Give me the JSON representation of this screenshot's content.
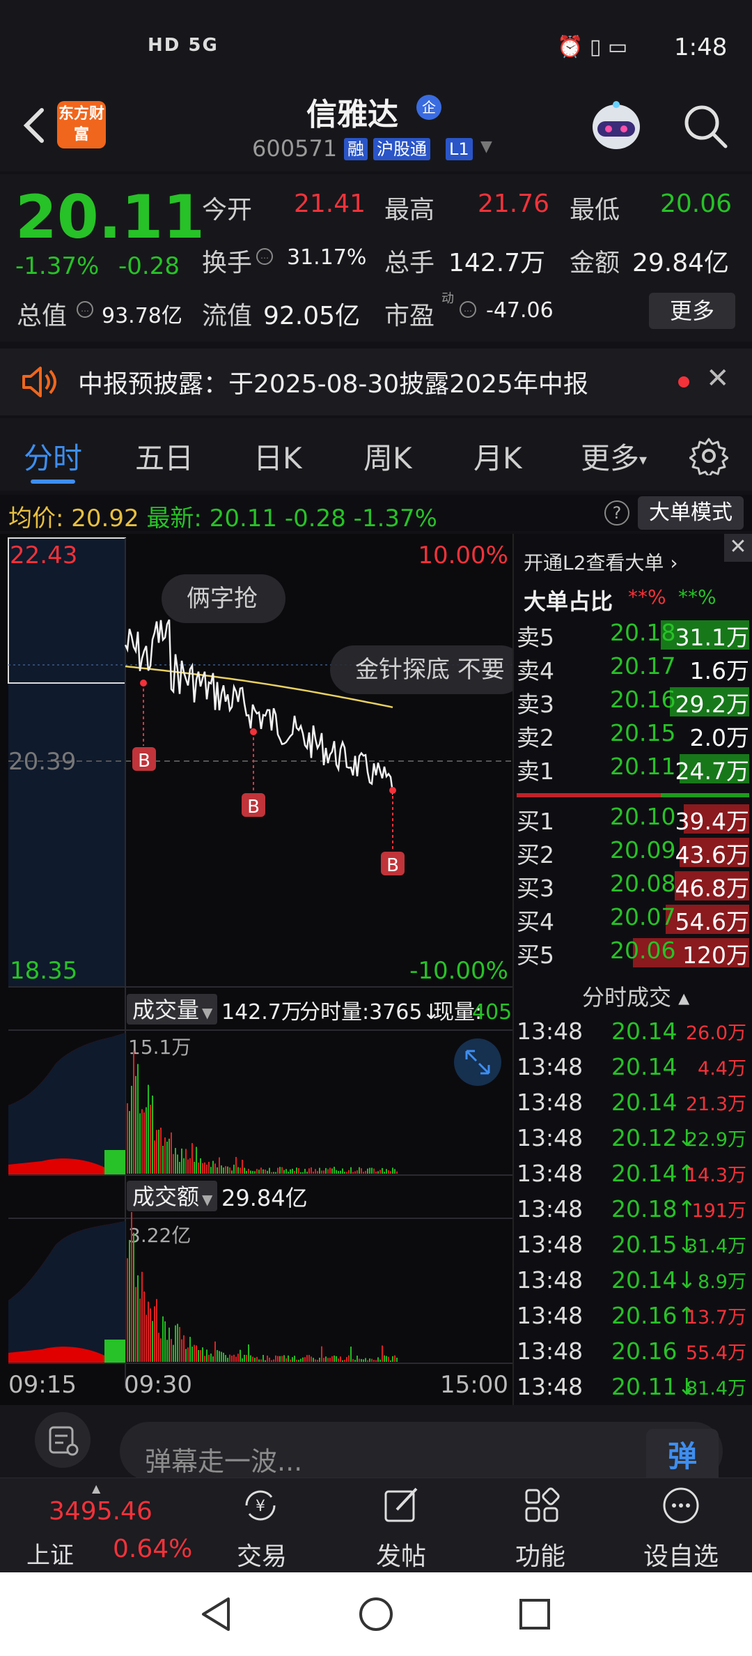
{
  "status": {
    "network": "HD 5G",
    "time": "1:48"
  },
  "header": {
    "logo": "东方财富",
    "stock_name": "信雅达",
    "qi_badge": "企",
    "stock_code": "600571",
    "tags": [
      "融",
      "沪股通",
      "L1"
    ]
  },
  "quote": {
    "price": "20.11",
    "pct": "-1.37%",
    "change": "-0.28",
    "open_label": "今开",
    "open": "21.41",
    "high_label": "最高",
    "high": "21.76",
    "low_label": "最低",
    "low": "20.06",
    "turnover_label": "换手",
    "turnover": "31.17%",
    "volume_label": "总手",
    "volume": "142.7万",
    "amount_label": "金额",
    "amount": "29.84亿",
    "mktcap_label": "总值",
    "mktcap": "93.78亿",
    "float_label": "流值",
    "float": "92.05亿",
    "pe_label": "市盈",
    "pe_sup": "动",
    "pe": "-47.06",
    "more_button": "更多"
  },
  "notice": {
    "text": "中报预披露：于2025-08-30披露2025年中报"
  },
  "tabs": [
    "分时",
    "五日",
    "日K",
    "周K",
    "月K",
    "更多"
  ],
  "avg_row": {
    "avg_label": "均价:",
    "avg": "20.92",
    "latest_label": "最新:",
    "latest": "20.11",
    "change": "-0.28",
    "pct": "-1.37%",
    "help": "?",
    "big_order_button": "大单模式"
  },
  "chart": {
    "y_top": "22.43",
    "y_mid": "20.39",
    "y_bottom": "18.35",
    "pct_top": "10.00%",
    "pct_bottom": "-10.00%",
    "bubble1": "俩字抢",
    "bubble2": "金针探底 不要",
    "marker": "B",
    "volume_label": "成交量",
    "volume_total": "142.7万",
    "fenshi_label": "分时量:3765↓",
    "xianliang_label": "现量:",
    "xianliang_value": "405",
    "vol_axis": "15.1万",
    "amount_label": "成交额",
    "amount_total": "29.84亿",
    "amt_axis": "3.22亿",
    "x_labels": [
      "09:15",
      "09:30",
      "15:00"
    ]
  },
  "right_panel": {
    "l2_link": "开通L2查看大单 ›",
    "close": "✕",
    "big_ratio_label": "大单占比",
    "big_ratio_red": "**%",
    "big_ratio_green": "**%",
    "asks": [
      {
        "label": "卖5",
        "price": "20.18",
        "vol": "31.1万",
        "bar": "green",
        "barw": 0.38
      },
      {
        "label": "卖4",
        "price": "20.17",
        "vol": "1.6万",
        "bar": "none",
        "barw": 0
      },
      {
        "label": "卖3",
        "price": "20.16",
        "vol": "29.2万",
        "bar": "green",
        "barw": 0.34
      },
      {
        "label": "卖2",
        "price": "20.15",
        "vol": "2.0万",
        "bar": "none",
        "barw": 0
      },
      {
        "label": "卖1",
        "price": "20.11",
        "vol": "24.7万",
        "bar": "green",
        "barw": 0.3
      }
    ],
    "bids": [
      {
        "label": "买1",
        "price": "20.10",
        "vol": "39.4万",
        "bar": "red",
        "barw": 0.28
      },
      {
        "label": "买2",
        "price": "20.09",
        "vol": "43.6万",
        "bar": "red",
        "barw": 0.3
      },
      {
        "label": "买3",
        "price": "20.08",
        "vol": "46.8万",
        "bar": "red",
        "barw": 0.32
      },
      {
        "label": "买4",
        "price": "20.07",
        "vol": "54.6万",
        "bar": "red",
        "barw": 0.36
      },
      {
        "label": "买5",
        "price": "20.06",
        "vol": "120万",
        "bar": "red",
        "barw": 0.5
      }
    ],
    "trades_header": "分时成交 ▴",
    "trades": [
      {
        "time": "13:48",
        "price": "20.14",
        "vol": "26.0万",
        "color": "red"
      },
      {
        "time": "13:48",
        "price": "20.14",
        "vol": "4.4万",
        "color": "red"
      },
      {
        "time": "13:48",
        "price": "20.14",
        "vol": "21.3万",
        "color": "red"
      },
      {
        "time": "13:48",
        "price": "20.12↓",
        "vol": "22.9万",
        "color": "green"
      },
      {
        "time": "13:48",
        "price": "20.14↑",
        "vol": "14.3万",
        "color": "red"
      },
      {
        "time": "13:48",
        "price": "20.18↑",
        "vol": "191万",
        "color": "red"
      },
      {
        "time": "13:48",
        "price": "20.15↓",
        "vol": "31.4万",
        "color": "green"
      },
      {
        "time": "13:48",
        "price": "20.14↓",
        "vol": "8.9万",
        "color": "green"
      },
      {
        "time": "13:48",
        "price": "20.16↑",
        "vol": "13.7万",
        "color": "red"
      },
      {
        "time": "13:48",
        "price": "20.16",
        "vol": "55.4万",
        "color": "red"
      },
      {
        "time": "13:48",
        "price": "20.11↓",
        "vol": "81.4万",
        "color": "green"
      }
    ]
  },
  "danmu": {
    "placeholder": "弹幕走一波...",
    "send": "弹"
  },
  "bottom_nav": {
    "index_value": "3495.46",
    "index_name": "上证",
    "index_pct": "0.64%",
    "items": [
      "交易",
      "发帖",
      "功能",
      "设自选"
    ]
  },
  "colors": {
    "up": "#f3323a",
    "down": "#27c227",
    "accent": "#3e8ef0",
    "avg_line": "#e8d060"
  }
}
